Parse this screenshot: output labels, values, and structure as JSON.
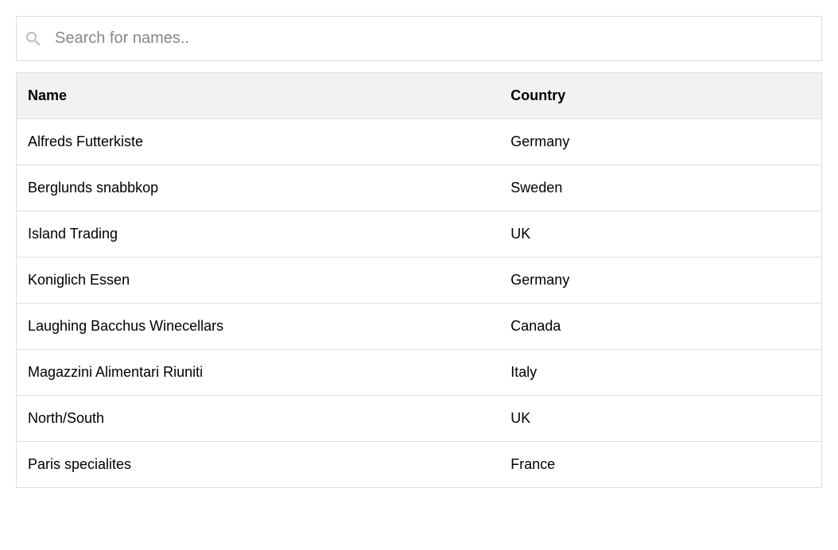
{
  "search": {
    "placeholder": "Search for names..",
    "value": ""
  },
  "table": {
    "headers": {
      "name": "Name",
      "country": "Country"
    },
    "rows": [
      {
        "name": "Alfreds Futterkiste",
        "country": "Germany"
      },
      {
        "name": "Berglunds snabbkop",
        "country": "Sweden"
      },
      {
        "name": "Island Trading",
        "country": "UK"
      },
      {
        "name": "Koniglich Essen",
        "country": "Germany"
      },
      {
        "name": "Laughing Bacchus Winecellars",
        "country": "Canada"
      },
      {
        "name": "Magazzini Alimentari Riuniti",
        "country": "Italy"
      },
      {
        "name": "North/South",
        "country": "UK"
      },
      {
        "name": "Paris specialites",
        "country": "France"
      }
    ]
  }
}
